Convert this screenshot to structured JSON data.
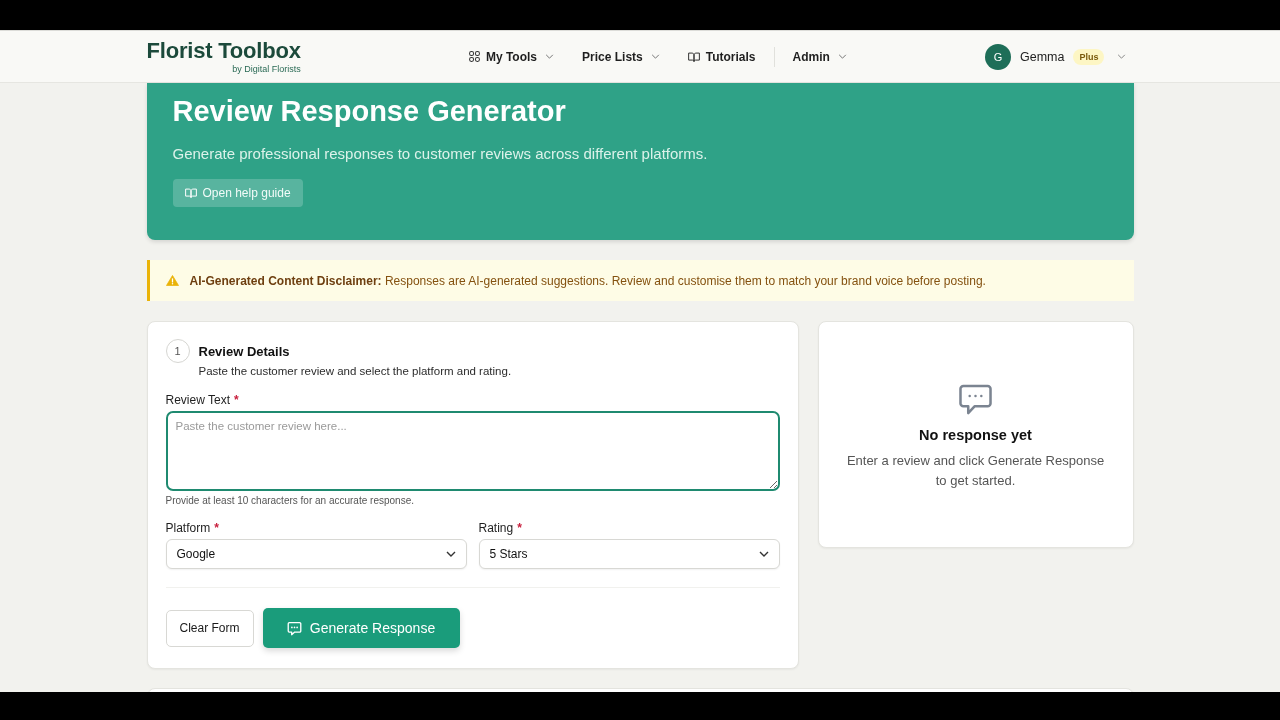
{
  "header": {
    "logo": {
      "title": "Florist Toolbox",
      "byline": "by Digital Florists"
    },
    "nav": [
      {
        "label": "My Tools",
        "dropdown": true,
        "separator_before": false
      },
      {
        "label": "Price Lists",
        "dropdown": true,
        "separator_before": false
      },
      {
        "label": "Tutorials",
        "dropdown": false,
        "separator_before": false
      },
      {
        "label": "Admin",
        "dropdown": true,
        "separator_before": true
      }
    ],
    "user": {
      "initial": "G",
      "name": "Gemma",
      "badge": "Plus"
    }
  },
  "hero": {
    "title": "Review Response Generator",
    "subtitle": "Generate professional responses to customer reviews across different platforms.",
    "button": "Open help guide"
  },
  "disclaimer": {
    "text": "**AI-Generated Content Disclaimer:** Responses are AI-generated suggestions. Review and customise them to match your brand voice before posting."
  },
  "form": {
    "step": "1",
    "title": "Review Details",
    "description": "Paste the customer review and select the platform and rating.",
    "fields": [
      {
        "kind": "textarea",
        "label": "Review Text",
        "required_mark": "*",
        "placeholder": "Paste the customer review here...",
        "focused": true,
        "hint": "Provide at least 10 characters for an accurate response."
      },
      {
        "kind": "select",
        "label": "Platform",
        "required_mark": "*",
        "value": "Google"
      },
      {
        "kind": "select",
        "label": "Rating",
        "required_mark": "*",
        "value": "5 Stars"
      }
    ],
    "buttons": [
      {
        "label": "Clear Form",
        "kind": "secondary"
      },
      {
        "label": "Generate Response",
        "kind": "primary"
      }
    ]
  },
  "response": {
    "title": "No response yet",
    "message": "Enter a review and click Generate Response to get started."
  }
}
